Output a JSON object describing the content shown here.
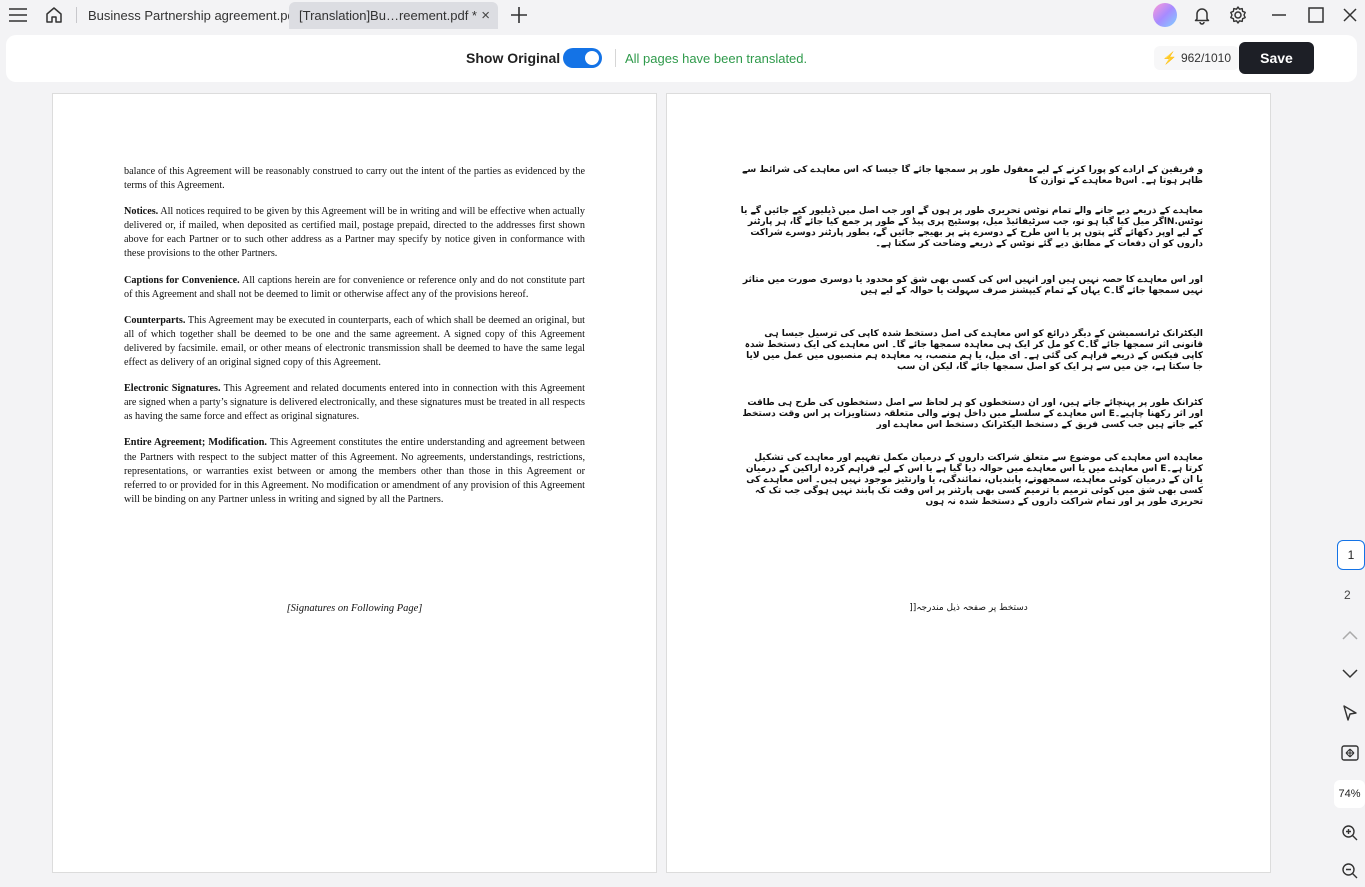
{
  "titlebar": {
    "tabs": [
      {
        "label": "Business Partnership agreement.pdf"
      },
      {
        "label": "[Translation]Bu…reement.pdf *"
      }
    ],
    "tab_close_glyph": "×",
    "new_tab_glyph": "+"
  },
  "toolbar": {
    "show_original_label": "Show Original",
    "show_original_on": true,
    "status_text": "All pages have been translated.",
    "credits": "962/1010",
    "save_label": "Save"
  },
  "document": {
    "intro": "balance of this Agreement will be reasonably construed to carry out the intent of the parties as evidenced by the terms of this Agreement.",
    "sections": [
      {
        "heading": "Notices.",
        "body": " All notices required to be given by this Agreement will be in writing and will be effective when actually delivered or, if mailed, when deposited as certified mail, postage prepaid, directed to the addresses first shown above for each Partner or to such other address as a Partner may specify by notice given in conformance with these provisions to the other Partners."
      },
      {
        "heading": "Captions for Convenience.",
        "body": " All captions herein are for convenience or reference only and do not constitute part of this Agreement and shall not be deemed to limit or otherwise affect any of the provisions hereof."
      },
      {
        "heading": "Counterparts.",
        "body": " This Agreement may be executed in counterparts, each of which shall be deemed an original, but all of which together shall be deemed to be one and the same agreement. A signed copy of this Agreement delivered by facsimile. email, or other means of electronic transmission shall be deemed to have the same legal effect as delivery of an original signed copy of this Agreement."
      },
      {
        "heading": "Electronic Signatures.",
        "body": " This Agreement and related documents entered into in connection with this Agreement are signed when a party’s signature is delivered electronically, and these signatures must be treated in all respects as having the same force and effect as original signatures."
      },
      {
        "heading": "Entire Agreement; Modification.",
        "body": " This Agreement constitutes the entire understanding and agreement between the Partners with respect to the subject matter of this Agreement. No agreements, understandings, restrictions, representations, or warranties exist between or among the members other than those in this Agreement or referred to or provided for in this Agreement. No modification or amendment of any provision of this Agreement will be binding on any Partner unless in writing and signed by all the Partners."
      }
    ],
    "signature_note": "[Signatures on Following Page]"
  },
  "translation": {
    "blocks": [
      "و فریقین کے ارادے کو پورا کرنے کے لیے معقول طور پر سمجھا جائے گا جیسا کہ اس معاہدے کی شرائط سے ظاہر ہوتا ہے۔ اسb معاہدے کے توازن کا",
      "معاہدے کے ذریعے دیے جانے والے تمام نوٹس تحریری طور پر ہوں گے اور جب اصل میں ڈیلیور کیے جائیں گے یا نوٹس.Nاگر میل کیا گیا ہو تو، جب سرٹیفائیڈ میل، پوسٹیج پری پیڈ کے طور پر جمع کیا جائے گا، ہر پارٹنر کے لیے اوپر دکھائے گئے پتوں پر یا اس طرح کے دوسرے پتے پر بھیجے جائیں گے، بطور پارٹنر دوسرے شراکت داروں کو ان دفعات کے مطابق دیے گئے نوٹس کے ذریعے وضاحت کر سکتا ہے۔",
      "اور اس معاہدے کا حصہ نہیں ہیں اور انہیں اس کی کسی بھی شق کو محدود یا دوسری صورت میں متاثر نہیں سمجھا جائے گا۔C یہاں کے تمام کیپشنز صرف سہولت یا حوالہ کے لیے ہیں",
      "الیکٹرانک ٹرانسمیشن کے دیگر ذرائع کو اس معاہدے کی اصل دستخط شدہ کاپی کی ترسیل جیسا ہی قانونی اثر سمجھا جائے گا۔C کو مل کر ایک ہی معاہدہ سمجھا جائے گا۔ اس معاہدے کی ایک دستخط شدہ کاپی فیکس کے ذریعے فراہم کی گئی ہے۔ ای میل، یا ہم منصب، یہ معاہدہ ہم منصبوں میں عمل میں لایا جا سکتا ہے، جن میں سے ہر ایک کو اصل سمجھا جائے گا، لیکن ان سب",
      "کٹرانک طور پر پہنچائے جاتے ہیں، اور ان دستخطوں کو ہر لحاظ سے اصل دستخطوں کی طرح ہی طاقت اور اثر رکھنا چاہیے۔E اس معاہدے کے سلسلے میں داخل ہونے والی متعلقہ دستاویزات پر اس وقت دستخط کیے جاتے ہیں جب کسی فریق کے دستخط الیکٹرانک دستخط اس معاہدے اور",
      "معاہدہ اس معاہدے کی موضوع سے متعلق شراکت داروں کے درمیان مکمل تفہیم اور معاہدے کی تشکیل کرتا ہے۔E اس معاہدے میں یا اس معاہدے میں حوالہ دیا گیا ہے یا اس کے لیے فراہم کردہ اراکین کے درمیان یا ان کے درمیان کوئی معاہدے، سمجھوتے، پابندیاں، نمائندگی، یا وارنٹیز موجود نہیں ہیں۔ اس معاہدے کی کسی بھی شق میں کوئی ترمیم یا ترمیم کسی بھی پارٹنر پر اس وقت تک پابند نہیں ہوگی جب تک کہ تحریری طور پر اور تمام شراکت داروں کے دستخط شدہ نہ ہوں"
    ],
    "signature_note": "دستخط پر صفحہ ذیل مندرجہ[["
  },
  "sidebar": {
    "current_page": "1",
    "next_page": "2",
    "zoom": "74%"
  }
}
